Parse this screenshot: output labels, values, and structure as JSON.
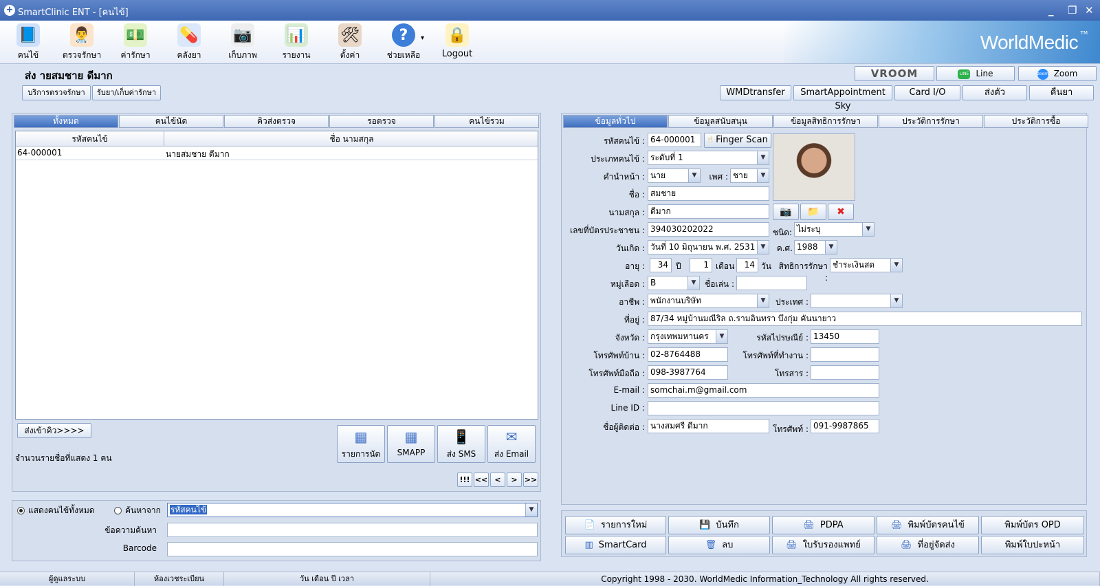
{
  "window": {
    "title": "SmartClinic ENT - [คนไข้]",
    "min": "_",
    "restore": "❐",
    "close": "✕"
  },
  "toolbar": {
    "items": [
      {
        "label": "คนไข้",
        "icon": "patient-book-icon",
        "glyph": "📘"
      },
      {
        "label": "ตรวจรักษา",
        "icon": "doctor-icon",
        "glyph": "👨‍⚕️"
      },
      {
        "label": "ค่ารักษา",
        "icon": "money-icon",
        "glyph": "💵"
      },
      {
        "label": "คลังยา",
        "icon": "pill-icon",
        "glyph": "💊"
      },
      {
        "label": "เก็บภาพ",
        "icon": "camera-icon",
        "glyph": "📷"
      },
      {
        "label": "รายงาน",
        "icon": "bar-chart-icon",
        "glyph": "📊"
      },
      {
        "label": "ตั้งค่า",
        "icon": "tools-icon",
        "glyph": "🛠"
      },
      {
        "label": "ช่วยเหลือ",
        "icon": "help-icon",
        "glyph": "?"
      },
      {
        "label": "Logout",
        "icon": "lock-icon",
        "glyph": "🔒"
      }
    ],
    "help_arrow": "▾",
    "brand": "WorldMedic",
    "brand_tm": "TM"
  },
  "header": {
    "patient_title": "ส่ง  ายสมชาย ดีมาก",
    "vroom": "VROOM",
    "line": "Line",
    "zoom": "Zoom",
    "line_icon": "LINE",
    "zoom_icon": "zoom"
  },
  "actions_left": [
    "บริการตรวจรักษา",
    "รับยา/เก็บค่ารักษา"
  ],
  "actions_right": [
    "WMDtransfer",
    "SmartAppointment Sky",
    "Card I/O",
    "ส่งตัว",
    "คืนยา"
  ],
  "left": {
    "tabs": [
      "ทั้งหมด",
      "คนไข้นัด",
      "คิวส่งตรวจ",
      "รอตรวจ",
      "คนไข้รวม"
    ],
    "columns": [
      "รหัสคนไข้",
      "ชื่อ นามสกุล"
    ],
    "rows": [
      [
        "64-000001",
        "นายสมชาย ดีมาก"
      ]
    ],
    "send_queue": "ส่งเข้าคิว>>>>",
    "count_text": "จำนวนรายชื่อที่แสดง 1 คน",
    "buttons": [
      "รายการนัด",
      "SMAPP",
      "ส่ง SMS",
      "ส่ง Email"
    ],
    "pager": [
      "!!!",
      "<<",
      "<",
      ">",
      ">>"
    ],
    "radio_all": "แสดงคนไข้ทั้งหมด",
    "radio_search": "ค้นหาจาก",
    "search_by": "รหัสคนไข้",
    "search_text_label": "ข้อความค้นหา",
    "barcode_label": "Barcode"
  },
  "right": {
    "tabs": [
      "ข้อมูลทั่วไป",
      "ข้อมูลสนับสนุน",
      "ข้อมูลสิทธิการรักษา",
      "ประวัติการรักษา",
      "ประวัติการซื้อ"
    ],
    "fields": {
      "hn_label": "รหัสคนไข้ :",
      "hn": "64-000001",
      "finger": "Finger Scan",
      "type_label": "ประเภทคนไข้ :",
      "type": "ระดับที่ 1",
      "prefix_label": "คำนำหน้า :",
      "prefix": "นาย",
      "sex_label": "เพศ :",
      "sex": "ชาย",
      "fname_label": "ชื่อ :",
      "fname": "สมชาย",
      "lname_label": "นามสกุล :",
      "lname": "ดีมาก",
      "idcard_label": "เลขที่บัตรประชาชน :",
      "idcard": "394030202022",
      "idtype_label": "ชนิด:",
      "idtype": "ไม่ระบุ",
      "dob_label": "วันเกิด :",
      "dob": "วันที่ 10  มิถุนายน  พ.ศ.  2531",
      "ad_label": "ค.ศ.",
      "ad": "1988",
      "age_label": "อายุ :",
      "age_y": "34",
      "y": "ปี",
      "age_m": "1",
      "m": "เดือน",
      "age_d": "14",
      "d": "วัน",
      "right_label": "สิทธิการรักษา :",
      "right": "ชำระเงินสด",
      "blood_label": "หมู่เลือด :",
      "blood": "B",
      "nick_label": "ชื่อเล่น :",
      "nick": "",
      "job_label": "อาชีพ :",
      "job": "พนักงานบริษัท",
      "country_label": "ประเทศ :",
      "country": "",
      "addr_label": "ที่อยู่ :",
      "addr": "87/34 หมู่บ้านมณีริล ถ.รามอินทรา บึงกุ่ม คันนายาว",
      "prov_label": "จังหวัด :",
      "prov": "กรุงเทพมหานคร",
      "zip_label": "รหัสไปรษณีย์ :",
      "zip": "13450",
      "tel_label": "โทรศัพท์บ้าน :",
      "tel": "02-8764488",
      "work_label": "โทรศัพท์ที่ทำงาน :",
      "work": "",
      "mob_label": "โทรศัพท์มือถือ :",
      "mob": "098-3987764",
      "fax_label": "โทรสาร :",
      "fax": "",
      "email_label": "E-mail :",
      "email": "somchai.m@gmail.com",
      "line_label": "Line ID :",
      "line": "",
      "contact_label": "ชื่อผู้ติดต่อ :",
      "contact": "นางสมศรี ดีมาก",
      "ctel_label": "โทรศัพท์ :",
      "ctel": "091-9987865"
    },
    "buttons": [
      [
        "รายการใหม่",
        "บันทึก",
        "PDPA",
        "พิมพ์บัตรคนไข้",
        "พิมพ์บัตร OPD"
      ],
      [
        "SmartCard",
        "ลบ",
        "ใบรับรองแพทย์",
        "ที่อยู่จัดส่ง",
        "พิมพ์ใบปะหน้า"
      ]
    ]
  },
  "status": [
    "ผู้ดูแลระบบ",
    "ห้องเวชระเบียน",
    "วัน เดือน ปี เวลา",
    "Copyright 1998 - 2030. WorldMedic Information_Technology All rights reserved."
  ]
}
